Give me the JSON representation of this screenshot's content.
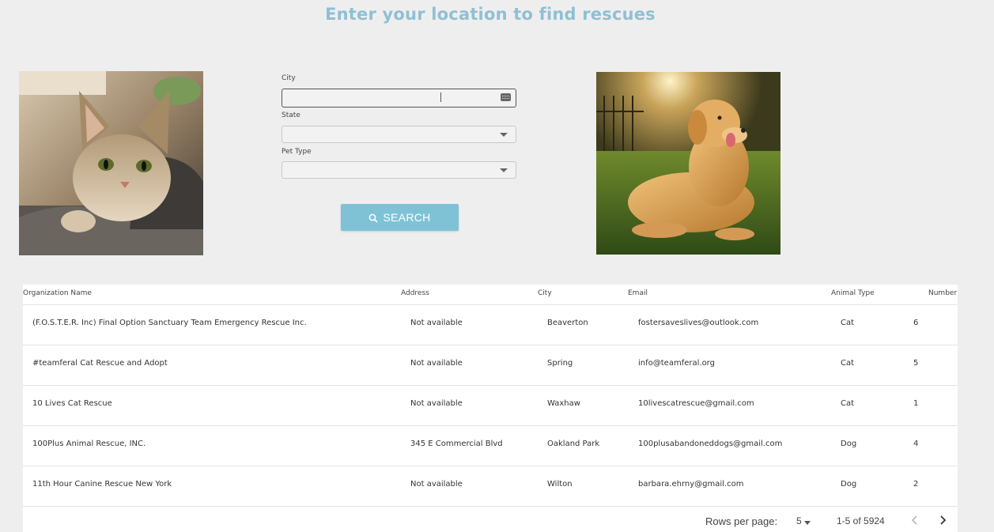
{
  "header": {
    "title": "Enter your location to find rescues"
  },
  "images": {
    "left": {
      "icon": "cat-photo"
    },
    "right": {
      "icon": "dog-photo"
    }
  },
  "form": {
    "city": {
      "label": "City",
      "value": "",
      "icon": "keyboard-icon"
    },
    "state": {
      "label": "State",
      "value": ""
    },
    "pet_type": {
      "label": "Pet Type",
      "value": ""
    },
    "search_button": {
      "label": "SEARCH",
      "icon": "search-icon"
    }
  },
  "table": {
    "columns": [
      "Organization Name",
      "Address",
      "City",
      "Email",
      "Animal Type",
      "Number"
    ],
    "rows": [
      [
        "(F.O.S.T.E.R. Inc) Final Option Sanctuary Team Emergency Rescue Inc.",
        "Not available",
        "Beaverton",
        "fostersaveslives@outlook.com",
        "Cat",
        "6"
      ],
      [
        "#teamferal Cat Rescue and Adopt",
        "Not available",
        "Spring",
        "info@teamferal.org",
        "Cat",
        "5"
      ],
      [
        "10 Lives Cat Rescue",
        "Not available",
        "Waxhaw",
        "10livescatrescue@gmail.com",
        "Cat",
        "1"
      ],
      [
        "100Plus Animal Rescue, INC.",
        "345 E Commercial Blvd",
        "Oakland Park",
        "100plusabandoneddogs@gmail.com",
        "Dog",
        "4"
      ],
      [
        "11th Hour Canine Rescue New York",
        "Not available",
        "Wilton",
        "barbara.ehrny@gmail.com",
        "Dog",
        "2"
      ]
    ]
  },
  "pagination": {
    "rows_per_page_label": "Rows per page:",
    "rows_per_page_value": "5",
    "range": "1-5 of 5924"
  },
  "colors": {
    "accent": "#7fc2d6",
    "title": "#8fc0d3",
    "background": "#efeeef"
  }
}
